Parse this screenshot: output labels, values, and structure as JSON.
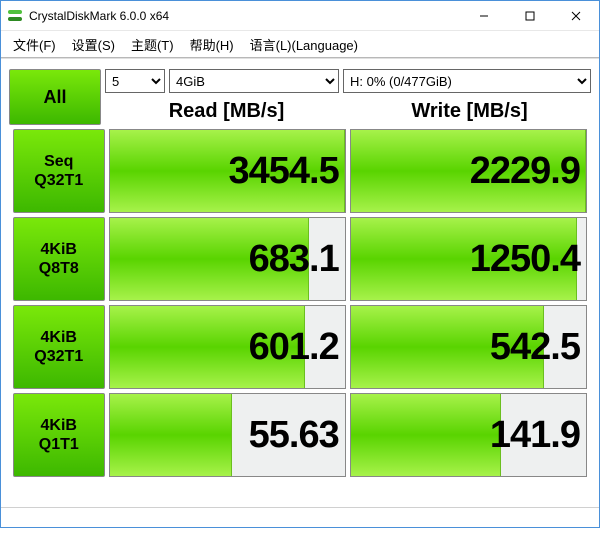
{
  "titlebar": {
    "icon": "cdm-icon",
    "title": "CrystalDiskMark 6.0.0 x64"
  },
  "menu": {
    "file": "文件(F)",
    "settings": "设置(S)",
    "theme": "主题(T)",
    "help": "帮助(H)",
    "language": "语言(L)(Language)"
  },
  "controls": {
    "all_label": "All",
    "runs": "5",
    "test_size": "4GiB",
    "drive": "H: 0% (0/477GiB)"
  },
  "headers": {
    "read": "Read [MB/s]",
    "write": "Write [MB/s]"
  },
  "rows": [
    {
      "name": "seq-q32t1",
      "line1": "Seq",
      "line2": "Q32T1",
      "read": "3454.5",
      "read_pct": 100,
      "write": "2229.9",
      "write_pct": 100
    },
    {
      "name": "4kib-q8t8",
      "line1": "4KiB",
      "line2": "Q8T8",
      "read": "683.1",
      "read_pct": 85,
      "write": "1250.4",
      "write_pct": 96
    },
    {
      "name": "4kib-q32t1",
      "line1": "4KiB",
      "line2": "Q32T1",
      "read": "601.2",
      "read_pct": 83,
      "write": "542.5",
      "write_pct": 82
    },
    {
      "name": "4kib-q1t1",
      "line1": "4KiB",
      "line2": "Q1T1",
      "read": "55.63",
      "read_pct": 52,
      "write": "141.9",
      "write_pct": 64
    }
  ]
}
